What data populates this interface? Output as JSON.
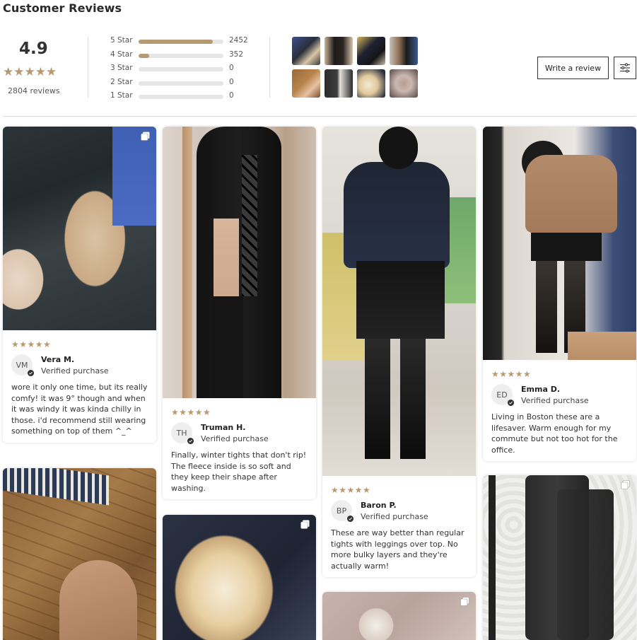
{
  "header": {
    "title": "Customer Reviews"
  },
  "summary": {
    "average": "4.9",
    "total_label": "2804 reviews",
    "distribution": [
      {
        "label": "5 Star",
        "count": "2452",
        "fraction": 0.874
      },
      {
        "label": "4 Star",
        "count": "352",
        "fraction": 0.126
      },
      {
        "label": "3 Star",
        "count": "0",
        "fraction": 0
      },
      {
        "label": "2 Star",
        "count": "0",
        "fraction": 0
      },
      {
        "label": "1 Star",
        "count": "0",
        "fraction": 0
      }
    ],
    "star_glyphs": "★★★★★"
  },
  "actions": {
    "write_review_label": "Write a review",
    "filter_icon": "sliders-icon"
  },
  "colors": {
    "accent": "#b69a72",
    "badge": "#333333"
  },
  "reviews": [
    {
      "initials": "VM",
      "name": "Vera M.",
      "verified": "Verified purchase",
      "stars": "★★★★★",
      "text": "wore it only one time, but its really comfy! it was 9° though and when it was windy it was kinda chilly in those. i'd recommend still wearing something on top of them ^_^"
    },
    {
      "initials": "TH",
      "name": "Truman H.",
      "verified": "Verified purchase",
      "stars": "★★★★★",
      "text": "Finally, winter tights that don't rip! The fleece inside is so soft and they keep their shape after washing."
    },
    {
      "initials": "BP",
      "name": "Baron P.",
      "verified": "Verified purchase",
      "stars": "★★★★★",
      "text": "These are way better than regular tights with leggings over top. No more bulky layers and they're actually warm!"
    },
    {
      "initials": "ED",
      "name": "Emma D.",
      "verified": "Verified purchase",
      "stars": "★★★★★",
      "text": "Living in Boston these are a lifesaver. Warm enough for my commute but not too hot for the office."
    }
  ]
}
